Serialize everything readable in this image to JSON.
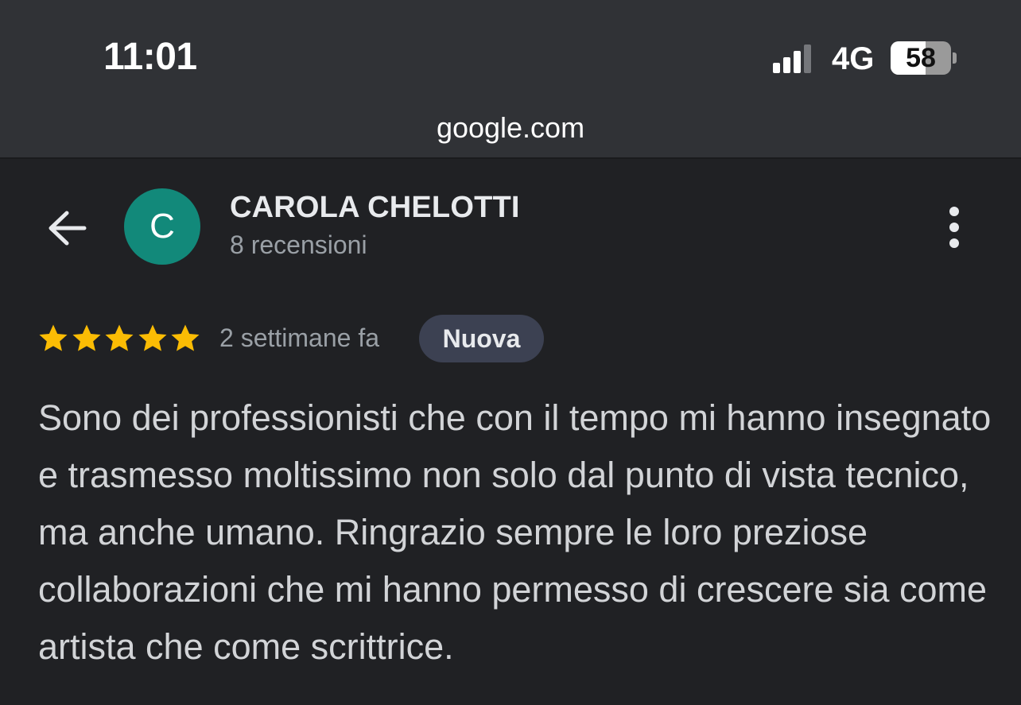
{
  "status_bar": {
    "time": "11:01",
    "network": "4G",
    "battery_percent": "58",
    "battery_level": 0.58
  },
  "browser": {
    "url": "google.com"
  },
  "reviewer": {
    "avatar_initial": "C",
    "avatar_color": "#12897a",
    "name": "CAROLA CHELOTTI",
    "reviews_count": "8 recensioni"
  },
  "review": {
    "rating": 5,
    "max_rating": 5,
    "star_color": "#fbbc04",
    "time_ago": "2 settimane fa",
    "badge": "Nuova",
    "text": "Sono dei professionisti che con il tempo mi hanno insegnato e trasmesso moltissimo non solo dal punto di vista tecnico, ma anche umano. Ringrazio sempre le loro preziose collaborazioni che mi hanno permesso di crescere sia come artista che come scrittrice."
  },
  "icons": {
    "back": "arrow-back-icon",
    "more": "more-vert-icon",
    "signal": "cellular-signal-icon",
    "battery": "battery-icon",
    "star": "star-icon"
  }
}
